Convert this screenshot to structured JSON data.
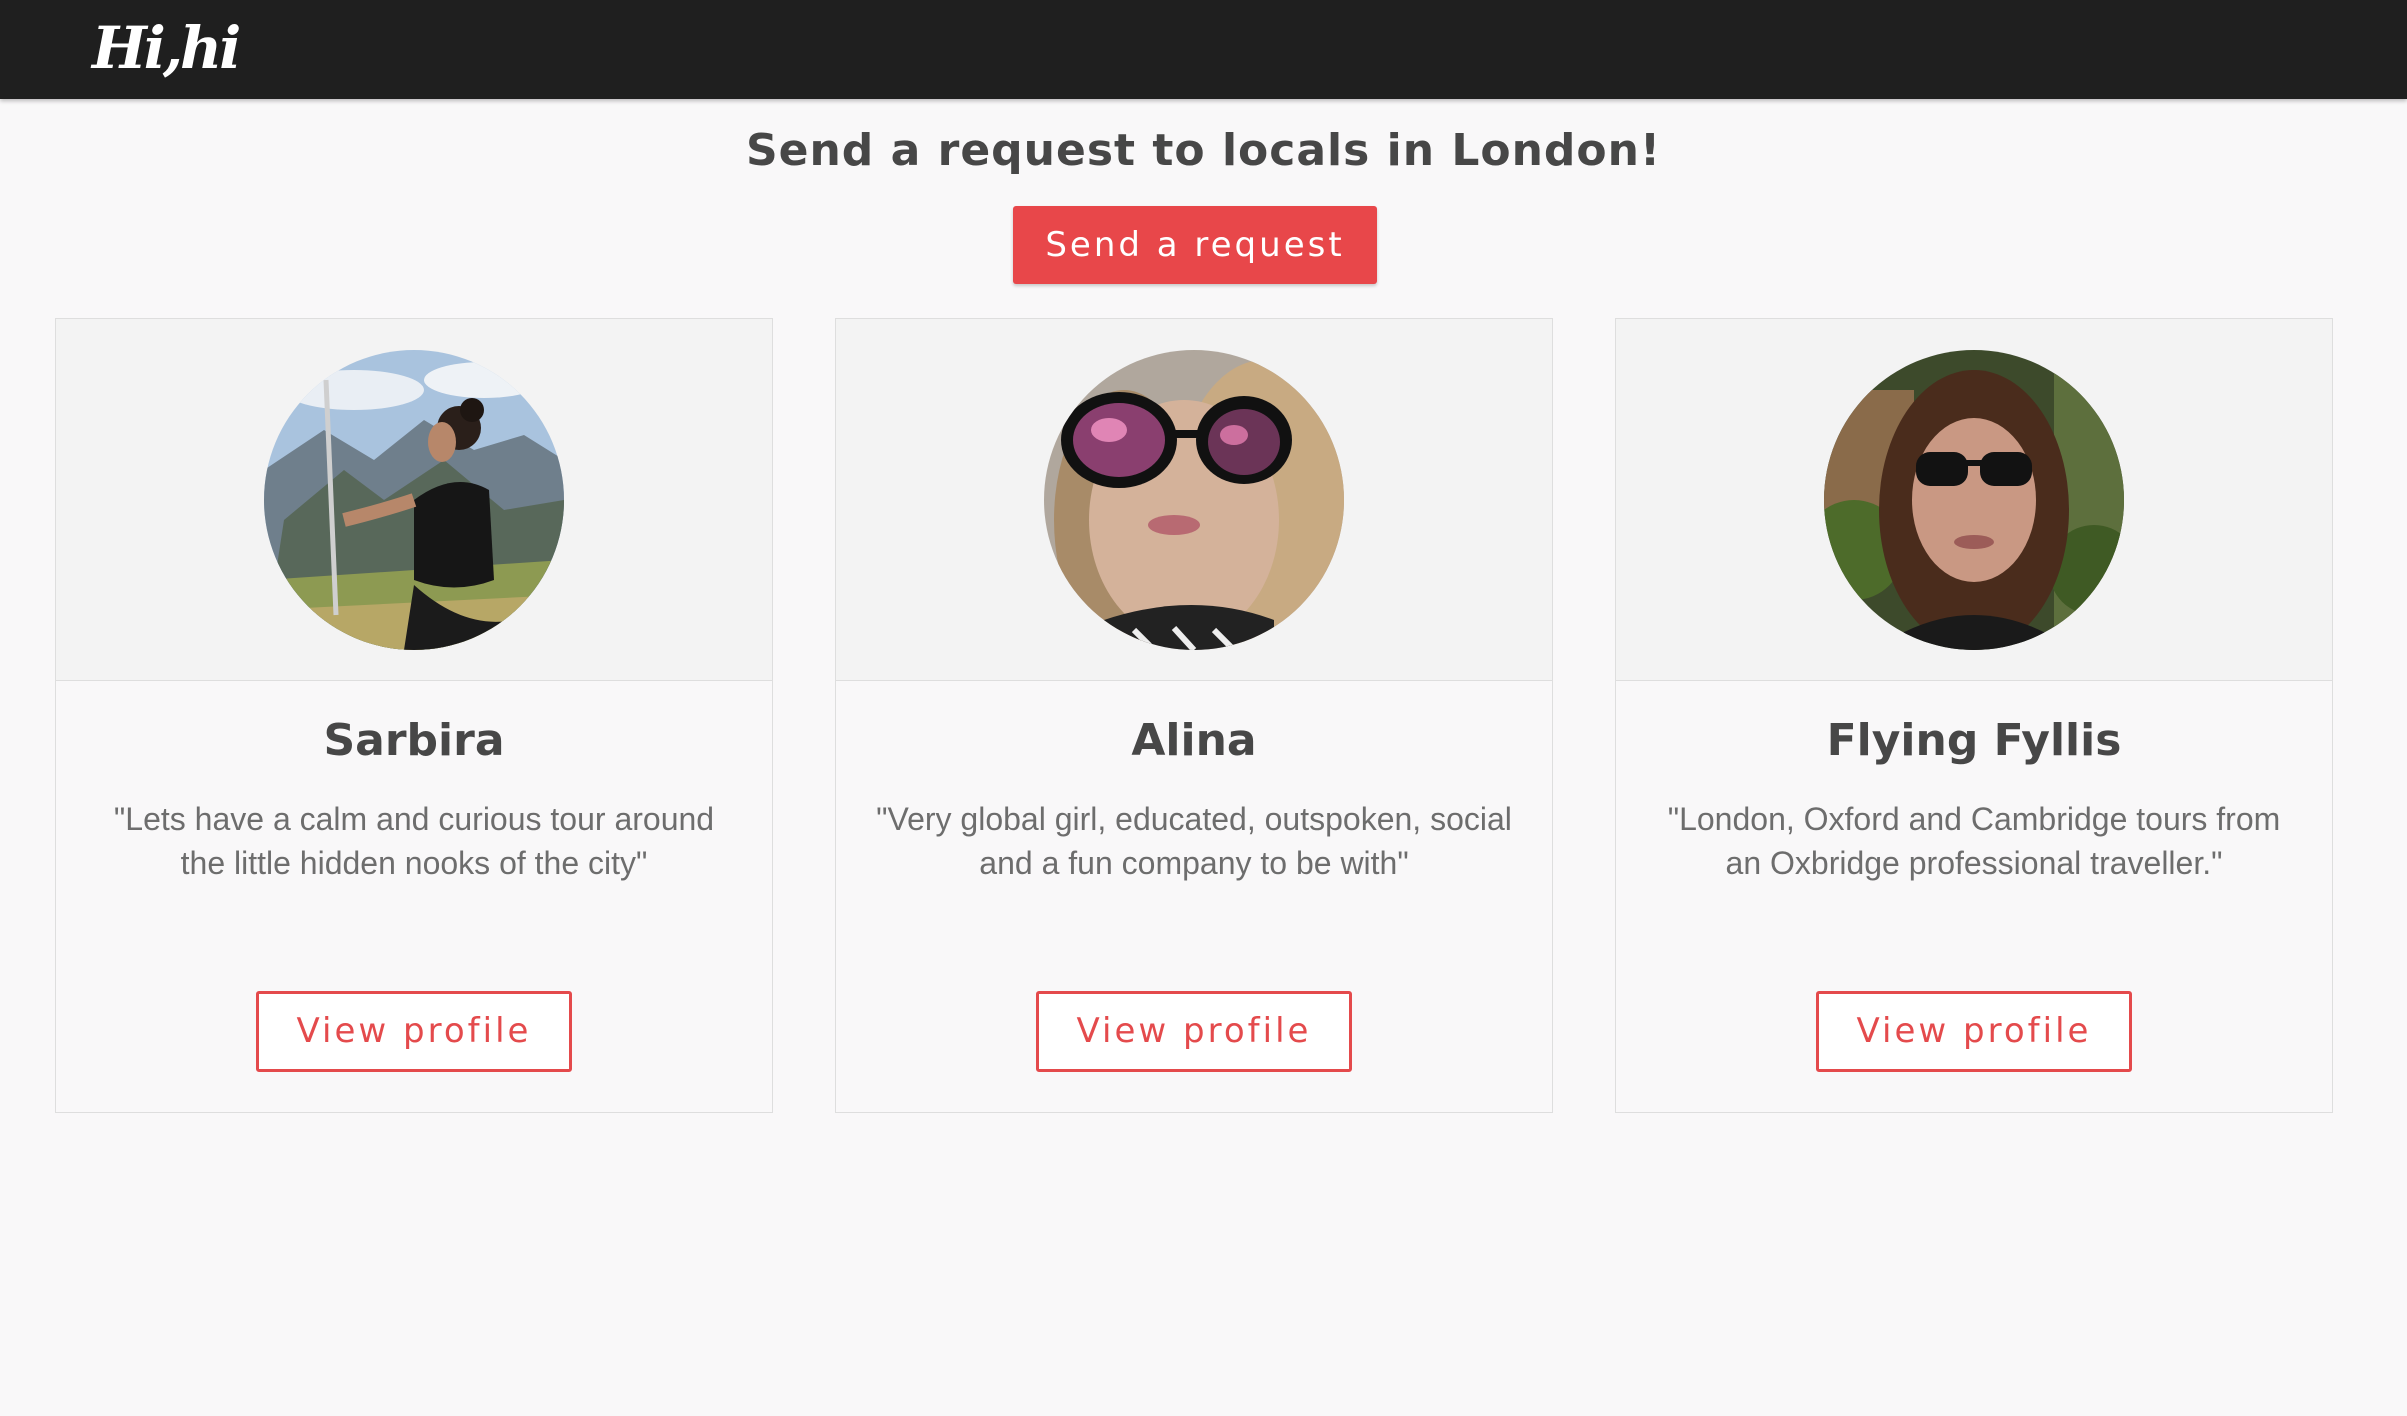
{
  "header": {
    "logo_text": "Hi,hi"
  },
  "main": {
    "headline": "Send a request to locals in London!",
    "cta_label": "Send a request"
  },
  "locals": [
    {
      "name": "Sarbira",
      "quote": "\"Lets have a calm and curious tour around the little hidden nooks of the city\"",
      "button_label": "View profile"
    },
    {
      "name": "Alina",
      "quote": "\"Very global girl, educated, outspoken, social and a fun company to be with\"",
      "button_label": "View profile"
    },
    {
      "name": "Flying Fyllis",
      "quote": "\"London, Oxford and Cambridge tours from an Oxbridge professional traveller.\"",
      "button_label": "View profile"
    }
  ],
  "colors": {
    "topbar": "#1f1f1f",
    "accent": "#e8474a",
    "page_bg": "#f9f8f9",
    "text": "#474747"
  }
}
